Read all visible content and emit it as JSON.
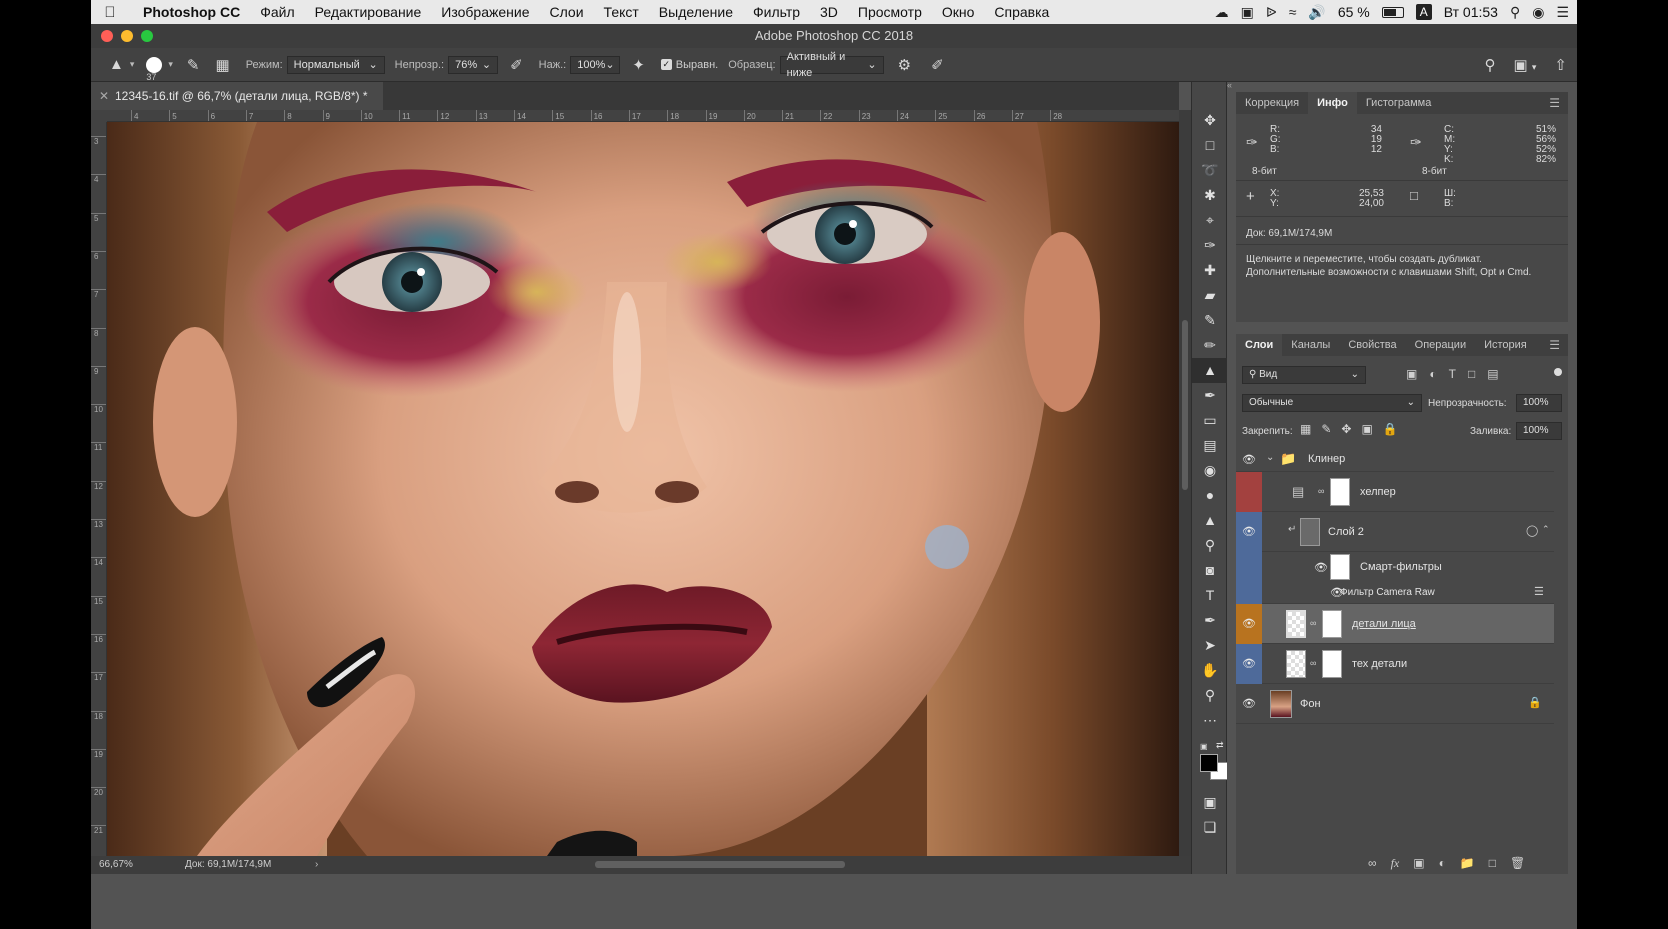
{
  "menubar": {
    "app_name": "Photoshop CC",
    "items": [
      "Файл",
      "Редактирование",
      "Изображение",
      "Слои",
      "Текст",
      "Выделение",
      "Фильтр",
      "3D",
      "Просмотр",
      "Окно",
      "Справка"
    ],
    "battery": "65 %",
    "input_source": "A",
    "clock": "Вт 01:53"
  },
  "window": {
    "title": "Adobe Photoshop CC 2018"
  },
  "options": {
    "brush_size": "37",
    "mode_label": "Режим:",
    "mode_value": "Нормальный",
    "opacity_label": "Непрозр.:",
    "opacity_value": "76%",
    "pressure_label": "Наж.:",
    "pressure_value": "100%",
    "aligned_label": "Выравн.",
    "sample_label": "Образец:",
    "sample_value": "Активный и ниже"
  },
  "document": {
    "tab_title": "12345-16.tif @ 66,7% (детали лица, RGB/8*) *",
    "zoom": "66,67%",
    "doc_size": "Док: 69,1M/174,9M"
  },
  "rulers": {
    "h_labels": [
      "4",
      "5",
      "6",
      "7",
      "8",
      "9",
      "10",
      "11",
      "12",
      "13",
      "14",
      "15",
      "16",
      "17",
      "18",
      "19",
      "20",
      "21",
      "22",
      "23",
      "24",
      "25",
      "26",
      "27",
      "28"
    ],
    "v_labels": [
      "3",
      "4",
      "5",
      "6",
      "7",
      "8",
      "9",
      "10",
      "11",
      "12",
      "13",
      "14",
      "15",
      "16",
      "17",
      "18",
      "19",
      "20",
      "21"
    ]
  },
  "info_panel": {
    "tabs": [
      "Коррекция",
      "Инфо",
      "Гистограмма"
    ],
    "active_tab": "Инфо",
    "rgb_labels": [
      "R:",
      "G:",
      "B:"
    ],
    "rgb_values": [
      "34",
      "19",
      "12"
    ],
    "cmyk_labels": [
      "C:",
      "M:",
      "Y:",
      "K:"
    ],
    "cmyk_values": [
      "51%",
      "56%",
      "52%",
      "82%"
    ],
    "bit_left": "8-бит",
    "bit_right": "8-бит",
    "xy_labels": [
      "X:",
      "Y:"
    ],
    "xy_values": [
      "25,53",
      "24,00"
    ],
    "wh_labels": [
      "Ш:",
      "В:"
    ],
    "doc_info": "Док: 69,1M/174,9M",
    "hint_line1": "Щелкните и переместите, чтобы создать дубликат.",
    "hint_line2": "Дополнительные возможности с клавишами Shift, Opt и Cmd."
  },
  "layers_panel": {
    "tabs": [
      "Слои",
      "Каналы",
      "Свойства",
      "Операции",
      "История"
    ],
    "active_tab": "Слои",
    "filter_placeholder": "Вид",
    "blend_mode": "Обычные",
    "opacity_label": "Непрозрачность:",
    "opacity_value": "100%",
    "lock_label": "Закрепить:",
    "fill_label": "Заливка:",
    "fill_value": "100%",
    "layers": [
      {
        "name": "Клинер",
        "type": "group",
        "color": "#535353"
      },
      {
        "name": "хелпер",
        "type": "adjustment",
        "color": "#a3413f"
      },
      {
        "name": "Слой 2",
        "type": "smart",
        "color": "#4e6a9a"
      },
      {
        "name": "Смарт-фильтры",
        "type": "smartfilter",
        "color": "#4e6a9a"
      },
      {
        "name": "Фильтр Camera Raw",
        "type": "filter",
        "color": "#4e6a9a"
      },
      {
        "name": "детали лица",
        "type": "pixel",
        "color": "#b8731f",
        "selected": true
      },
      {
        "name": "тех детали",
        "type": "pixel",
        "color": "#4e6a9a"
      },
      {
        "name": "Фон",
        "type": "background",
        "color": "#535353"
      }
    ]
  },
  "colors": {
    "ui_bg": "#535353",
    "panel_bg": "#484848",
    "selected_row": "#656565",
    "label_red": "#a3413f",
    "label_blue": "#4e6a9a",
    "label_orange": "#b8731f"
  }
}
